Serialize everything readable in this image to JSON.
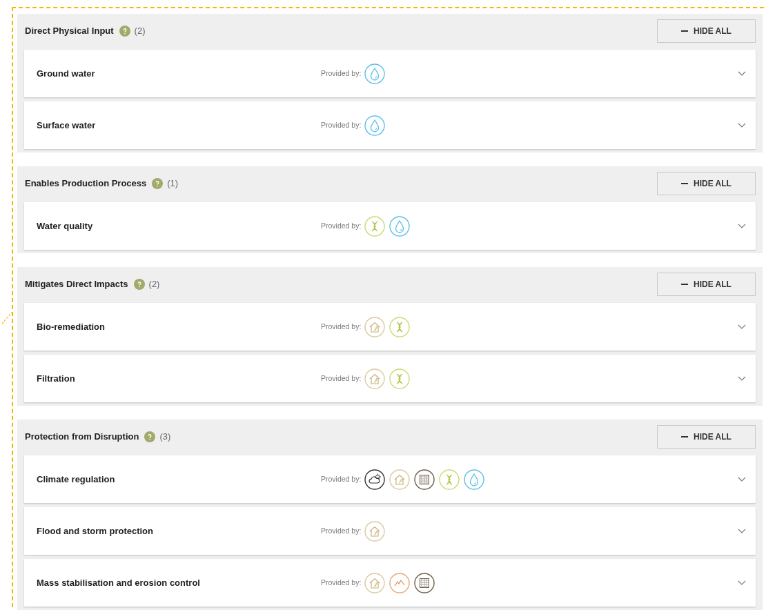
{
  "sections": [
    {
      "title": "Direct Physical Input",
      "count": "(2)",
      "button": "HIDE ALL",
      "items": [
        {
          "name": "Ground water",
          "provided_label": "Provided by:",
          "providers": [
            {
              "kind": "water"
            }
          ]
        },
        {
          "name": "Surface water",
          "provided_label": "Provided by:",
          "providers": [
            {
              "kind": "water"
            }
          ]
        }
      ]
    },
    {
      "title": "Enables Production Process",
      "count": "(1)",
      "button": "HIDE ALL",
      "items": [
        {
          "name": "Water quality",
          "provided_label": "Provided by:",
          "providers": [
            {
              "kind": "dna"
            },
            {
              "kind": "water"
            }
          ]
        }
      ]
    },
    {
      "title": "Mitigates Direct Impacts",
      "count": "(2)",
      "button": "HIDE ALL",
      "items": [
        {
          "name": "Bio-remediation",
          "provided_label": "Provided by:",
          "providers": [
            {
              "kind": "house"
            },
            {
              "kind": "dna"
            }
          ]
        },
        {
          "name": "Filtration",
          "provided_label": "Provided by:",
          "providers": [
            {
              "kind": "house"
            },
            {
              "kind": "dna"
            }
          ]
        }
      ]
    },
    {
      "title": "Protection from Disruption",
      "count": "(3)",
      "button": "HIDE ALL",
      "items": [
        {
          "name": "Climate regulation",
          "provided_label": "Provided by:",
          "providers": [
            {
              "kind": "weather"
            },
            {
              "kind": "house"
            },
            {
              "kind": "soil"
            },
            {
              "kind": "dna"
            },
            {
              "kind": "water"
            }
          ]
        },
        {
          "name": "Flood and storm protection",
          "provided_label": "Provided by:",
          "providers": [
            {
              "kind": "house"
            }
          ]
        },
        {
          "name": "Mass stabilisation and erosion control",
          "provided_label": "Provided by:",
          "providers": [
            {
              "kind": "house"
            },
            {
              "kind": "mountain"
            },
            {
              "kind": "soil"
            }
          ]
        }
      ]
    }
  ]
}
